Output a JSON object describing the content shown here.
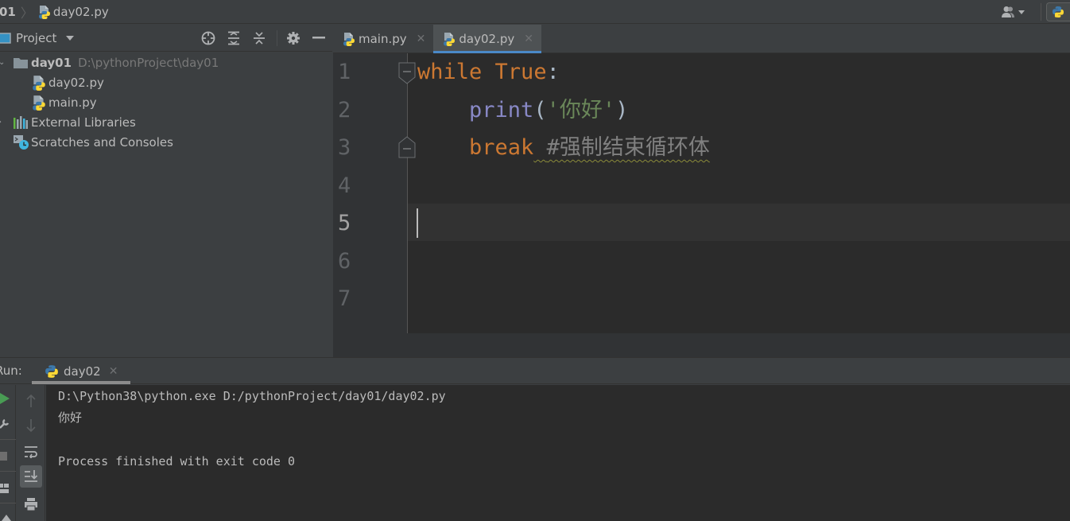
{
  "navbar": {
    "breadcrumb_root": "01",
    "breadcrumb_file": "day02.py"
  },
  "project_panel": {
    "title": "Project",
    "toolbar_icons": [
      "locate-icon",
      "expand-all-icon",
      "collapse-all-icon",
      "gear-icon",
      "minimize-icon"
    ],
    "tree": [
      {
        "name": "day01",
        "path": "D:\\pythonProject\\day01",
        "type": "folder",
        "expanded": true
      },
      {
        "name": "day02.py",
        "type": "python-file"
      },
      {
        "name": "main.py",
        "type": "python-file"
      },
      {
        "name": "External Libraries",
        "type": "libraries",
        "expanded": false
      },
      {
        "name": "Scratches and Consoles",
        "type": "scratches"
      }
    ]
  },
  "editor": {
    "tabs": [
      {
        "label": "main.py",
        "active": false
      },
      {
        "label": "day02.py",
        "active": true
      }
    ],
    "line_numbers": [
      "1",
      "2",
      "3",
      "4",
      "5",
      "6",
      "7"
    ],
    "current_line": 5,
    "code": {
      "line1_kw1": "while",
      "line1_kw2": "True",
      "line1_colon": ":",
      "line2_indent": "    ",
      "line2_builtin": "print",
      "line2_open": "(",
      "line2_str": "'你好'",
      "line2_close": ")",
      "line3_indent": "    ",
      "line3_kw": "break",
      "line3_space": " ",
      "line3_comment": "#强制结束循环体"
    }
  },
  "run_panel": {
    "label": "Run:",
    "tab_label": "day02",
    "console": [
      "D:\\Python38\\python.exe D:/pythonProject/day01/day02.py",
      "你好",
      "",
      "Process finished with exit code 0"
    ]
  },
  "colors": {
    "keyword": "#cc7832",
    "builtin": "#8888c6",
    "string": "#6a8759",
    "comment": "#808080",
    "tab_accent": "#4a88c7",
    "run_green": "#499c54"
  }
}
